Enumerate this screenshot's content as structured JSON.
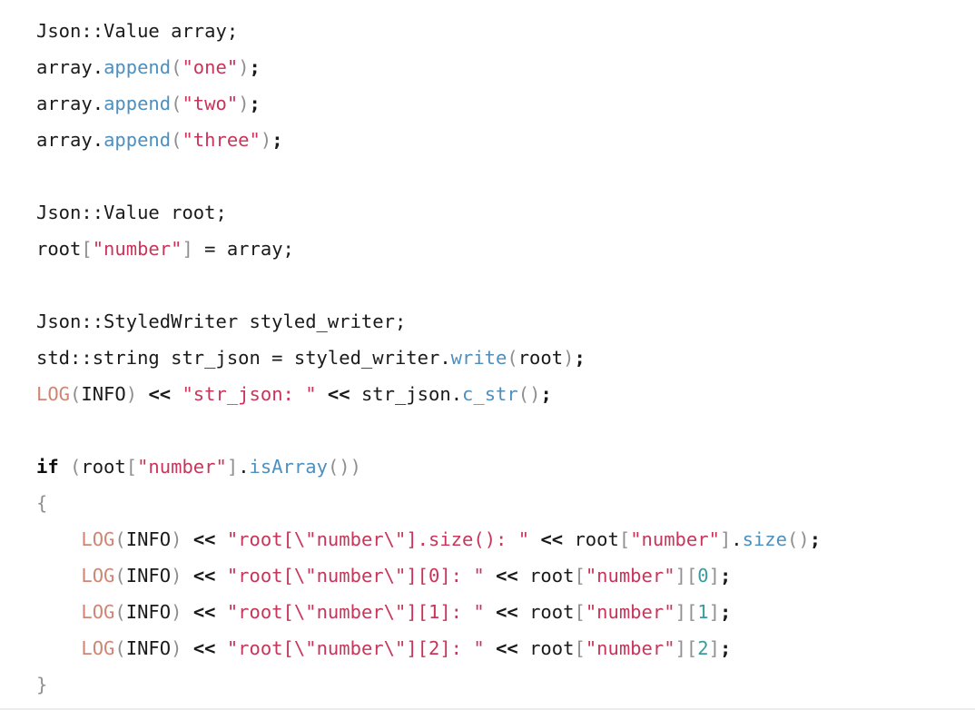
{
  "document": {
    "kind": "code-snippet",
    "language": "C++",
    "background_color": "#ffffff",
    "bottom_divider_color": "#ececec"
  },
  "palette": {
    "plain": "#1a1a1a",
    "keyword": "#0f0f0f",
    "function": "#4d8fbe",
    "macro": "#cf8573",
    "string": "#c8355a",
    "number": "#3c9a9e",
    "punctuation": "#8f8f8f",
    "operator": "#1a1a1a",
    "brace": "#8f8f8f"
  },
  "code": {
    "lines": [
      {
        "id": "line-1",
        "text": "Json::Value array;",
        "tokens": [
          {
            "t": "Json::Value array;",
            "c": "plain"
          }
        ]
      },
      {
        "id": "line-2",
        "text": "array.append(\"one\");",
        "tokens": [
          {
            "t": "array.",
            "c": "plain"
          },
          {
            "t": "append",
            "c": "fn"
          },
          {
            "t": "(",
            "c": "punct"
          },
          {
            "t": "\"one\"",
            "c": "string"
          },
          {
            "t": ")",
            "c": "punct"
          },
          {
            "t": ";",
            "c": "op"
          }
        ]
      },
      {
        "id": "line-3",
        "text": "array.append(\"two\");",
        "tokens": [
          {
            "t": "array.",
            "c": "plain"
          },
          {
            "t": "append",
            "c": "fn"
          },
          {
            "t": "(",
            "c": "punct"
          },
          {
            "t": "\"two\"",
            "c": "string"
          },
          {
            "t": ")",
            "c": "punct"
          },
          {
            "t": ";",
            "c": "op"
          }
        ]
      },
      {
        "id": "line-4",
        "text": "array.append(\"three\");",
        "tokens": [
          {
            "t": "array.",
            "c": "plain"
          },
          {
            "t": "append",
            "c": "fn"
          },
          {
            "t": "(",
            "c": "punct"
          },
          {
            "t": "\"three\"",
            "c": "string"
          },
          {
            "t": ")",
            "c": "punct"
          },
          {
            "t": ";",
            "c": "op"
          }
        ]
      },
      {
        "id": "line-5",
        "text": "",
        "tokens": []
      },
      {
        "id": "line-6",
        "text": "Json::Value root;",
        "tokens": [
          {
            "t": "Json::Value root;",
            "c": "plain"
          }
        ]
      },
      {
        "id": "line-7",
        "text": "root[\"number\"] = array;",
        "tokens": [
          {
            "t": "root",
            "c": "plain"
          },
          {
            "t": "[",
            "c": "punct"
          },
          {
            "t": "\"number\"",
            "c": "string"
          },
          {
            "t": "]",
            "c": "punct"
          },
          {
            "t": " = array;",
            "c": "plain"
          }
        ]
      },
      {
        "id": "line-8",
        "text": "",
        "tokens": []
      },
      {
        "id": "line-9",
        "text": "Json::StyledWriter styled_writer;",
        "tokens": [
          {
            "t": "Json::StyledWriter styled_writer;",
            "c": "plain"
          }
        ]
      },
      {
        "id": "line-10",
        "text": "std::string str_json = styled_writer.write(root);",
        "tokens": [
          {
            "t": "std::string str_json = styled_writer.",
            "c": "plain"
          },
          {
            "t": "write",
            "c": "fn"
          },
          {
            "t": "(",
            "c": "punct"
          },
          {
            "t": "root",
            "c": "plain"
          },
          {
            "t": ")",
            "c": "punct"
          },
          {
            "t": ";",
            "c": "op"
          }
        ]
      },
      {
        "id": "line-11",
        "text": "LOG(INFO) << \"str_json: \" << str_json.c_str();",
        "tokens": [
          {
            "t": "LOG",
            "c": "macro"
          },
          {
            "t": "(",
            "c": "punct"
          },
          {
            "t": "INFO",
            "c": "plain"
          },
          {
            "t": ")",
            "c": "punct"
          },
          {
            "t": " ",
            "c": "plain"
          },
          {
            "t": "<<",
            "c": "op"
          },
          {
            "t": " ",
            "c": "plain"
          },
          {
            "t": "\"str_json: \"",
            "c": "string"
          },
          {
            "t": " ",
            "c": "plain"
          },
          {
            "t": "<<",
            "c": "op"
          },
          {
            "t": " str_json.",
            "c": "plain"
          },
          {
            "t": "c_str",
            "c": "fn"
          },
          {
            "t": "(",
            "c": "punct"
          },
          {
            "t": ")",
            "c": "punct"
          },
          {
            "t": ";",
            "c": "op"
          }
        ]
      },
      {
        "id": "line-12",
        "text": "",
        "tokens": []
      },
      {
        "id": "line-13",
        "text": "if (root[\"number\"].isArray())",
        "tokens": [
          {
            "t": "if",
            "c": "keyword"
          },
          {
            "t": " ",
            "c": "plain"
          },
          {
            "t": "(",
            "c": "punct"
          },
          {
            "t": "root",
            "c": "plain"
          },
          {
            "t": "[",
            "c": "punct"
          },
          {
            "t": "\"number\"",
            "c": "string"
          },
          {
            "t": "]",
            "c": "punct"
          },
          {
            "t": ".",
            "c": "plain"
          },
          {
            "t": "isArray",
            "c": "fn"
          },
          {
            "t": "(",
            "c": "punct"
          },
          {
            "t": ")",
            "c": "punct"
          },
          {
            "t": ")",
            "c": "punct"
          }
        ]
      },
      {
        "id": "line-14",
        "text": "{",
        "tokens": [
          {
            "t": "{",
            "c": "brace"
          }
        ]
      },
      {
        "id": "line-15",
        "text": "    LOG(INFO) << \"root[\\\"number\\\"].size(): \" << root[\"number\"].size();",
        "tokens": [
          {
            "t": "    ",
            "c": "plain"
          },
          {
            "t": "LOG",
            "c": "macro"
          },
          {
            "t": "(",
            "c": "punct"
          },
          {
            "t": "INFO",
            "c": "plain"
          },
          {
            "t": ")",
            "c": "punct"
          },
          {
            "t": " ",
            "c": "plain"
          },
          {
            "t": "<<",
            "c": "op"
          },
          {
            "t": " ",
            "c": "plain"
          },
          {
            "t": "\"root[\\\"number\\\"].size(): \"",
            "c": "string"
          },
          {
            "t": " ",
            "c": "plain"
          },
          {
            "t": "<<",
            "c": "op"
          },
          {
            "t": " root",
            "c": "plain"
          },
          {
            "t": "[",
            "c": "punct"
          },
          {
            "t": "\"number\"",
            "c": "string"
          },
          {
            "t": "]",
            "c": "punct"
          },
          {
            "t": ".",
            "c": "plain"
          },
          {
            "t": "size",
            "c": "fn"
          },
          {
            "t": "(",
            "c": "punct"
          },
          {
            "t": ")",
            "c": "punct"
          },
          {
            "t": ";",
            "c": "op"
          }
        ]
      },
      {
        "id": "line-16",
        "text": "    LOG(INFO) << \"root[\\\"number\\\"][0]: \" << root[\"number\"][0];",
        "tokens": [
          {
            "t": "    ",
            "c": "plain"
          },
          {
            "t": "LOG",
            "c": "macro"
          },
          {
            "t": "(",
            "c": "punct"
          },
          {
            "t": "INFO",
            "c": "plain"
          },
          {
            "t": ")",
            "c": "punct"
          },
          {
            "t": " ",
            "c": "plain"
          },
          {
            "t": "<<",
            "c": "op"
          },
          {
            "t": " ",
            "c": "plain"
          },
          {
            "t": "\"root[\\\"number\\\"][0]: \"",
            "c": "string"
          },
          {
            "t": " ",
            "c": "plain"
          },
          {
            "t": "<<",
            "c": "op"
          },
          {
            "t": " root",
            "c": "plain"
          },
          {
            "t": "[",
            "c": "punct"
          },
          {
            "t": "\"number\"",
            "c": "string"
          },
          {
            "t": "]",
            "c": "punct"
          },
          {
            "t": "[",
            "c": "punct"
          },
          {
            "t": "0",
            "c": "number"
          },
          {
            "t": "]",
            "c": "punct"
          },
          {
            "t": ";",
            "c": "op"
          }
        ]
      },
      {
        "id": "line-17",
        "text": "    LOG(INFO) << \"root[\\\"number\\\"][1]: \" << root[\"number\"][1];",
        "tokens": [
          {
            "t": "    ",
            "c": "plain"
          },
          {
            "t": "LOG",
            "c": "macro"
          },
          {
            "t": "(",
            "c": "punct"
          },
          {
            "t": "INFO",
            "c": "plain"
          },
          {
            "t": ")",
            "c": "punct"
          },
          {
            "t": " ",
            "c": "plain"
          },
          {
            "t": "<<",
            "c": "op"
          },
          {
            "t": " ",
            "c": "plain"
          },
          {
            "t": "\"root[\\\"number\\\"][1]: \"",
            "c": "string"
          },
          {
            "t": " ",
            "c": "plain"
          },
          {
            "t": "<<",
            "c": "op"
          },
          {
            "t": " root",
            "c": "plain"
          },
          {
            "t": "[",
            "c": "punct"
          },
          {
            "t": "\"number\"",
            "c": "string"
          },
          {
            "t": "]",
            "c": "punct"
          },
          {
            "t": "[",
            "c": "punct"
          },
          {
            "t": "1",
            "c": "number"
          },
          {
            "t": "]",
            "c": "punct"
          },
          {
            "t": ";",
            "c": "op"
          }
        ]
      },
      {
        "id": "line-18",
        "text": "    LOG(INFO) << \"root[\\\"number\\\"][2]: \" << root[\"number\"][2];",
        "tokens": [
          {
            "t": "    ",
            "c": "plain"
          },
          {
            "t": "LOG",
            "c": "macro"
          },
          {
            "t": "(",
            "c": "punct"
          },
          {
            "t": "INFO",
            "c": "plain"
          },
          {
            "t": ")",
            "c": "punct"
          },
          {
            "t": " ",
            "c": "plain"
          },
          {
            "t": "<<",
            "c": "op"
          },
          {
            "t": " ",
            "c": "plain"
          },
          {
            "t": "\"root[\\\"number\\\"][2]: \"",
            "c": "string"
          },
          {
            "t": " ",
            "c": "plain"
          },
          {
            "t": "<<",
            "c": "op"
          },
          {
            "t": " root",
            "c": "plain"
          },
          {
            "t": "[",
            "c": "punct"
          },
          {
            "t": "\"number\"",
            "c": "string"
          },
          {
            "t": "]",
            "c": "punct"
          },
          {
            "t": "[",
            "c": "punct"
          },
          {
            "t": "2",
            "c": "number"
          },
          {
            "t": "]",
            "c": "punct"
          },
          {
            "t": ";",
            "c": "op"
          }
        ]
      },
      {
        "id": "line-19",
        "text": "}",
        "tokens": [
          {
            "t": "}",
            "c": "brace"
          }
        ]
      }
    ]
  }
}
